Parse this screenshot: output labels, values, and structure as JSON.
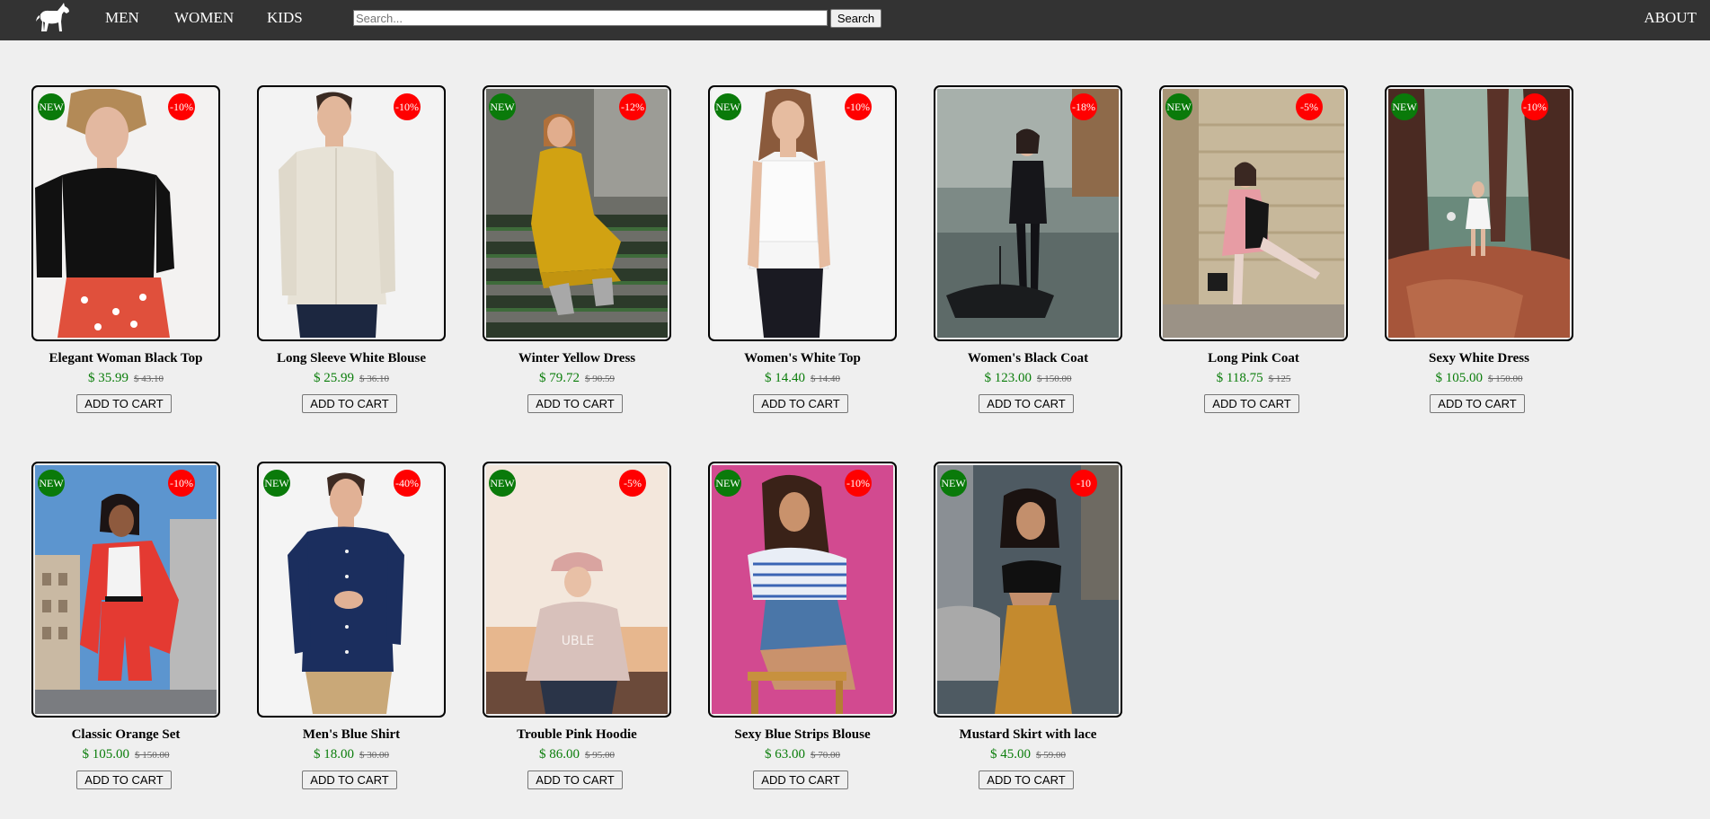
{
  "header": {
    "nav": [
      "MEN",
      "WOMEN",
      "KIDS"
    ],
    "search_placeholder": "Search...",
    "search_button": "Search",
    "about": "ABOUT"
  },
  "colors": {
    "topbar": "#333333",
    "page_background": "#efefef",
    "new_badge": "#0a7a0a",
    "discount_badge": "#ff0000",
    "price": "#0a7d0a"
  },
  "cart_label": "ADD TO CART",
  "products": [
    {
      "name": "Elegant Woman Black Top",
      "price": "$ 35.99",
      "old_price": "$ 43.10",
      "new_badge": "NEW",
      "discount": "-10%"
    },
    {
      "name": "Long Sleeve White Blouse",
      "price": "$ 25.99",
      "old_price": "$ 36.10",
      "new_badge": "",
      "discount": "-10%"
    },
    {
      "name": "Winter Yellow Dress",
      "price": "$ 79.72",
      "old_price": "$ 90.59",
      "new_badge": "NEW",
      "discount": "-12%"
    },
    {
      "name": "Women's White Top",
      "price": "$ 14.40",
      "old_price": "$ 14.40",
      "new_badge": "NEW",
      "discount": "-10%"
    },
    {
      "name": "Women's Black Coat",
      "price": "$ 123.00",
      "old_price": "$ 150.00",
      "new_badge": "",
      "discount": "-18%"
    },
    {
      "name": "Long Pink Coat",
      "price": "$ 118.75",
      "old_price": "$ 125",
      "new_badge": "NEW",
      "discount": "-5%"
    },
    {
      "name": "Sexy White Dress",
      "price": "$ 105.00",
      "old_price": "$ 150.00",
      "new_badge": "NEW",
      "discount": "-10%"
    },
    {
      "name": "Classic Orange Set",
      "price": "$ 105.00",
      "old_price": "$ 150.00",
      "new_badge": "NEW",
      "discount": "-10%"
    },
    {
      "name": "Men's Blue Shirt",
      "price": "$ 18.00",
      "old_price": "$ 30.00",
      "new_badge": "NEW",
      "discount": "-40%"
    },
    {
      "name": "Trouble Pink Hoodie",
      "price": "$ 86.00",
      "old_price": "$ 95.00",
      "new_badge": "NEW",
      "discount": "-5%"
    },
    {
      "name": "Sexy Blue Strips Blouse",
      "price": "$ 63.00",
      "old_price": "$ 70.00",
      "new_badge": "NEW",
      "discount": "-10%"
    },
    {
      "name": "Mustard Skirt with lace",
      "price": "$ 45.00",
      "old_price": "$ 59.00",
      "new_badge": "NEW",
      "discount": "-10"
    }
  ]
}
